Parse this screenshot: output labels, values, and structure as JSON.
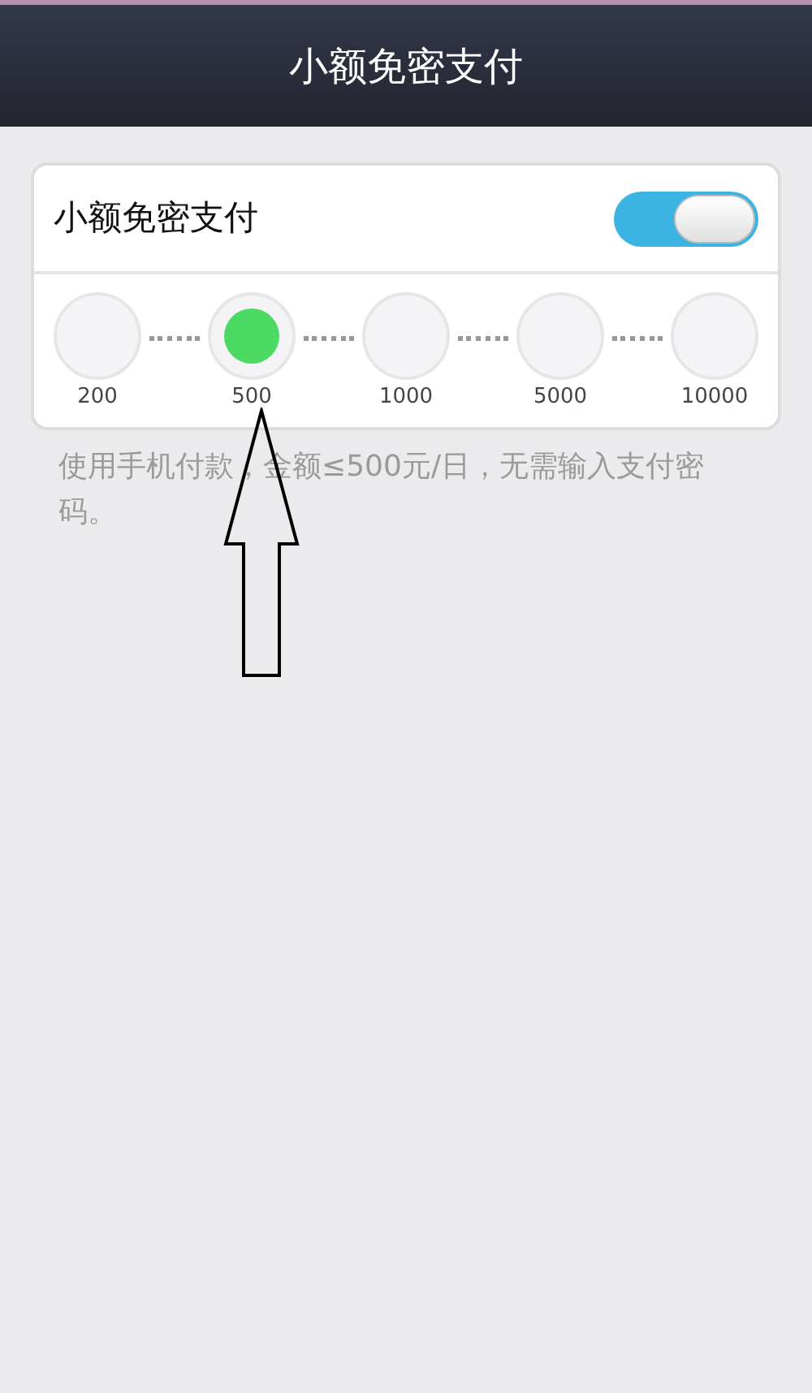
{
  "header": {
    "title": "小额免密支付"
  },
  "setting": {
    "label": "小额免密支付",
    "on": true
  },
  "limits": [
    {
      "label": "200",
      "selected": false
    },
    {
      "label": "500",
      "selected": true
    },
    {
      "label": "1000",
      "selected": false
    },
    {
      "label": "5000",
      "selected": false
    },
    {
      "label": "10000",
      "selected": false
    }
  ],
  "description": "使用手机付款，金额≤500元/日，无需输入支付密码。"
}
